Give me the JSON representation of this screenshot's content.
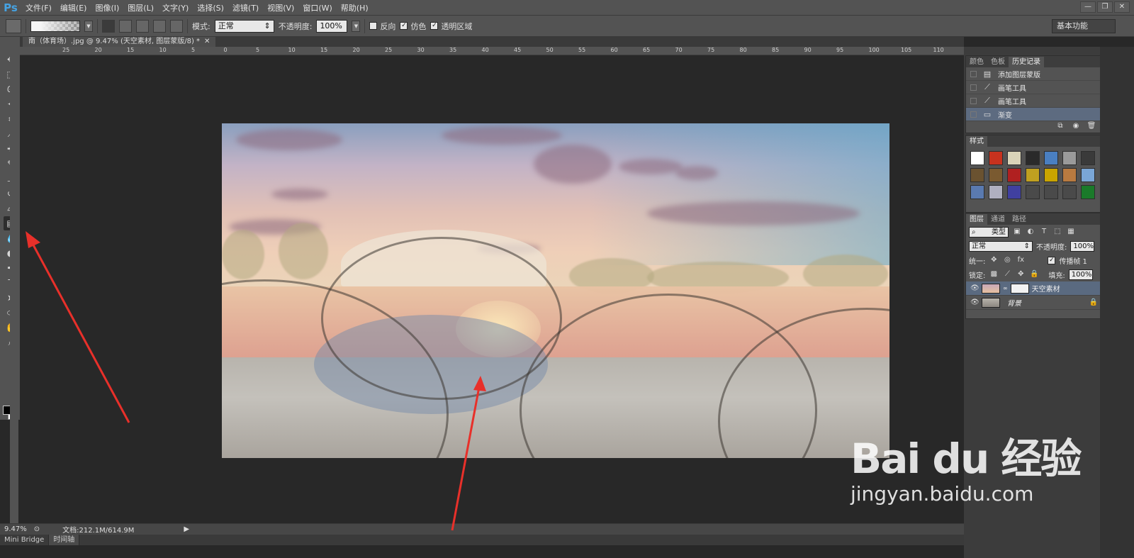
{
  "app": {
    "logo": "Ps",
    "menu": [
      "文件(F)",
      "编辑(E)",
      "图像(I)",
      "图层(L)",
      "文字(Y)",
      "选择(S)",
      "滤镜(T)",
      "视图(V)",
      "窗口(W)",
      "帮助(H)"
    ],
    "window_controls": [
      "—",
      "❐",
      "✕"
    ]
  },
  "options_bar": {
    "mode_label": "模式:",
    "mode_value": "正常",
    "opacity_label": "不透明度:",
    "opacity_value": "100%",
    "reverse_label": "反向",
    "reverse_checked": false,
    "dither_label": "仿色",
    "dither_checked": true,
    "transparency_label": "透明区域",
    "transparency_checked": true,
    "workspace": "基本功能"
  },
  "document": {
    "tab_title": "南（体育场）.jpg @ 9.47% (天空素材, 图层蒙版/8) *",
    "ruler_ticks": [
      "25",
      "20",
      "15",
      "10",
      "5",
      "0",
      "5",
      "10",
      "15",
      "20",
      "25",
      "30",
      "35",
      "40",
      "45",
      "50",
      "55",
      "60",
      "65",
      "70",
      "75",
      "80",
      "85",
      "90",
      "95",
      "100",
      "105",
      "110"
    ]
  },
  "tools": [
    {
      "name": "move-tool-icon",
      "glyph": "✥"
    },
    {
      "name": "marquee-tool-icon",
      "glyph": "⬚"
    },
    {
      "name": "lasso-tool-icon",
      "glyph": "ᘏ"
    },
    {
      "name": "magic-wand-tool-icon",
      "glyph": "✦"
    },
    {
      "name": "crop-tool-icon",
      "glyph": "⌗"
    },
    {
      "name": "eyedropper-tool-icon",
      "glyph": "⟋"
    },
    {
      "name": "healing-brush-tool-icon",
      "glyph": "✚"
    },
    {
      "name": "brush-tool-icon",
      "glyph": "✎"
    },
    {
      "name": "clone-stamp-tool-icon",
      "glyph": "⊥"
    },
    {
      "name": "history-brush-tool-icon",
      "glyph": "↺"
    },
    {
      "name": "eraser-tool-icon",
      "glyph": "▱"
    },
    {
      "name": "gradient-tool-icon",
      "glyph": "▤"
    },
    {
      "name": "blur-tool-icon",
      "glyph": "💧"
    },
    {
      "name": "dodge-tool-icon",
      "glyph": "●"
    },
    {
      "name": "pen-tool-icon",
      "glyph": "✒"
    },
    {
      "name": "type-tool-icon",
      "glyph": "T"
    },
    {
      "name": "path-selection-tool-icon",
      "glyph": "➤"
    },
    {
      "name": "ellipse-tool-icon",
      "glyph": "⬭"
    },
    {
      "name": "hand-tool-icon",
      "glyph": "✋"
    },
    {
      "name": "zoom-tool-icon",
      "glyph": "⌕"
    }
  ],
  "status": {
    "zoom": "9.47%",
    "doc_size": "文档:212.1M/614.9M",
    "tabs": [
      "Mini Bridge",
      "时间轴"
    ]
  },
  "history_panel": {
    "tabs": [
      "颜色",
      "色板",
      "历史记录"
    ],
    "items": [
      "添加图层蒙版",
      "画笔工具",
      "画笔工具",
      "渐变"
    ]
  },
  "styles_panel": {
    "title": "样式",
    "swatches": [
      "#ffffff",
      "#c8321e",
      "#d9d3b8",
      "#2a2a2a",
      "#4a7fc1",
      "#9a9a9a",
      "#3a3a3a",
      "#6a5230",
      "#7a5a30",
      "#b02020",
      "#c0a020",
      "#c9a400",
      "#b87a40",
      "#7aa6d6",
      "#5a7ab0",
      "#b0b0c0",
      "#4040a0",
      "#4a4a4a",
      "#4a4a4a",
      "#4a4a4a",
      "#1a7a2a"
    ]
  },
  "layers_panel": {
    "tabs": [
      "图层",
      "通道",
      "路径"
    ],
    "kind_label": "类型",
    "blend_mode": "正常",
    "opacity_label": "不透明度:",
    "opacity_value": "100%",
    "unify_label": "统一:",
    "propagate_label": "传播帧 1",
    "lock_label": "锁定:",
    "fill_label": "填充:",
    "fill_value": "100%",
    "layers": [
      {
        "name": "天空素材",
        "selected": true
      },
      {
        "name": "背景",
        "selected": false
      }
    ]
  },
  "watermark": {
    "logo": "Bai du 经验",
    "url": "jingyan.baidu.com"
  }
}
